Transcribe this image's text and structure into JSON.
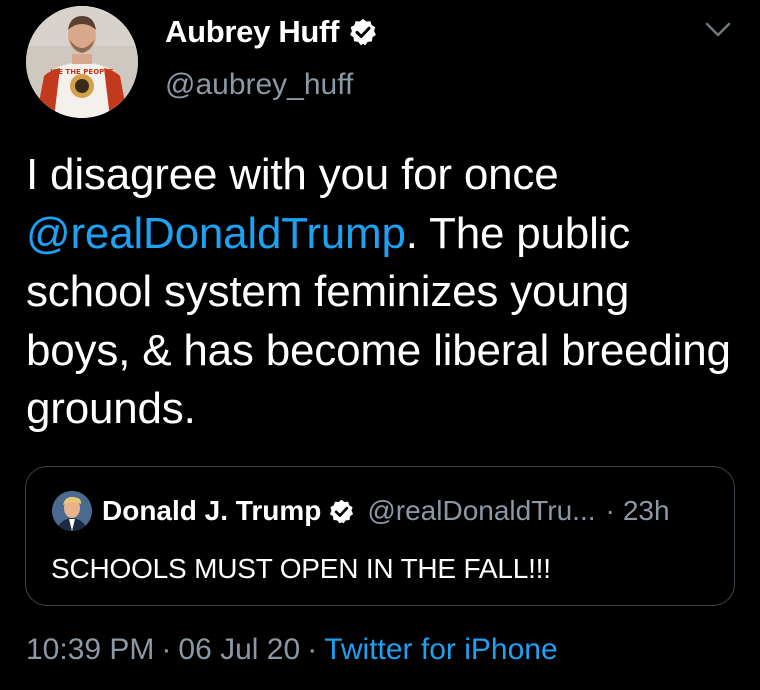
{
  "author": {
    "display_name": "Aubrey Huff",
    "handle": "@aubrey_huff",
    "verified": true,
    "avatar_icon": "profile-photo",
    "avatar_shirt_text": "WE THE PEOPLE"
  },
  "tweet": {
    "text_line_1": "I disagree with you for once",
    "mention": "@realDonaldTrump",
    "text_after_mention": ". The public school system feminizes young boys, & has become liberal breeding grounds."
  },
  "quoted_tweet": {
    "display_name": "Donald J. Trump",
    "handle": "@realDonaldTru...",
    "separator": "·",
    "time": "23h",
    "text": "SCHOOLS MUST OPEN IN THE FALL!!!",
    "verified": true
  },
  "meta": {
    "time": "10:39 PM",
    "separator": "·",
    "date": "06 Jul 20",
    "source": "Twitter for iPhone"
  },
  "colors": {
    "background": "#000000",
    "link": "#1da1f2",
    "secondary_text": "#8b98a5",
    "border": "#38444d"
  }
}
